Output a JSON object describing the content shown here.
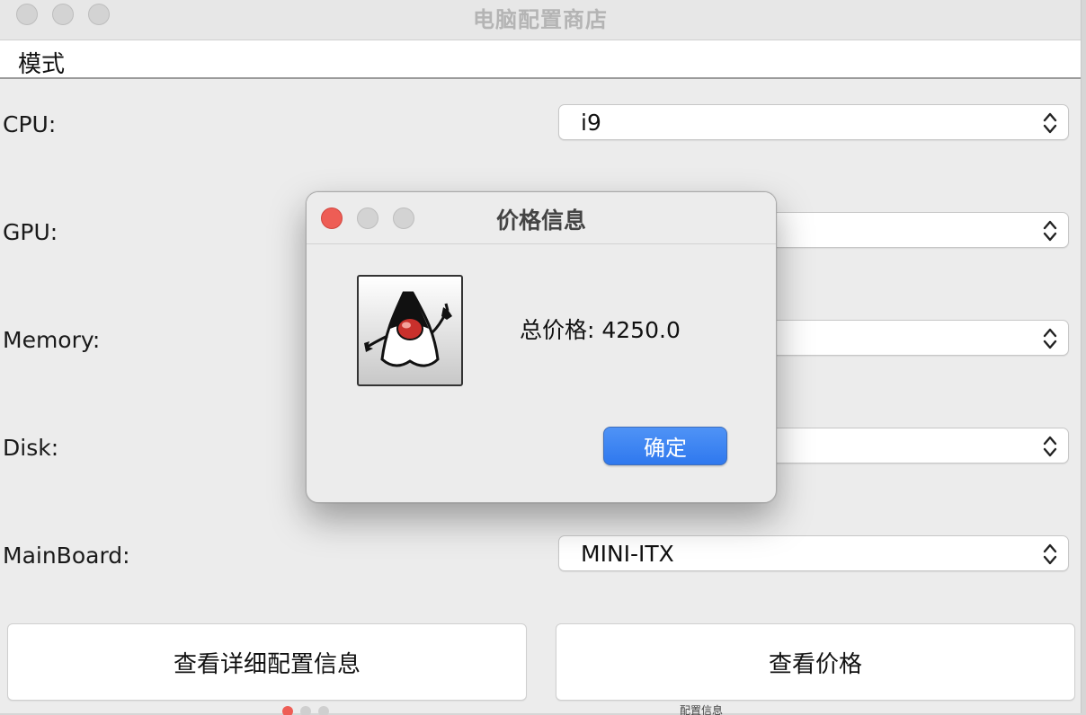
{
  "window": {
    "title": "电脑配置商店",
    "menu": {
      "items": [
        {
          "label": "模式"
        }
      ]
    },
    "form": {
      "rows": [
        {
          "label": "CPU:",
          "value": "i9"
        },
        {
          "label": "GPU:",
          "value": ""
        },
        {
          "label": "Memory:",
          "value": ""
        },
        {
          "label": "Disk:",
          "value": ""
        },
        {
          "label": "MainBoard:",
          "value": "MINI-ITX"
        }
      ]
    },
    "buttons": {
      "details_label": "查看详细配置信息",
      "price_label": "查看价格"
    }
  },
  "background_window": {
    "title": "配置信息"
  },
  "dialog": {
    "title": "价格信息",
    "message": "总价格: 4250.0",
    "ok_label": "确定",
    "icon": "java-duke-icon"
  },
  "colors": {
    "accent_blue": "#2f78ee",
    "close_red": "#ee5d55",
    "inactive_traffic": "#d3d3d3"
  }
}
